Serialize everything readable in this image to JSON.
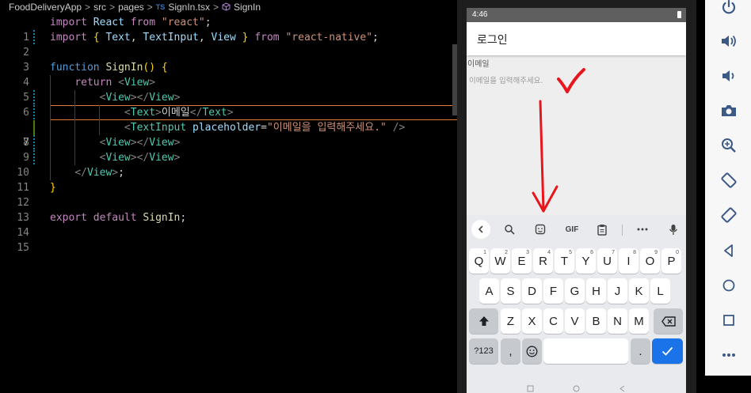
{
  "breadcrumb": {
    "items": [
      "FoodDeliveryApp",
      "src",
      "pages"
    ],
    "file_badge": "TS",
    "file": "SignIn.tsx",
    "symbol": "SignIn",
    "separator": ">"
  },
  "code": {
    "line_numbers": [
      "1",
      "2",
      "3",
      "4",
      "5",
      "6",
      "7",
      "8",
      "9",
      "10",
      "11",
      "12",
      "13",
      "14",
      "15"
    ],
    "active_line": "7"
  },
  "emulator": {
    "status_time": "4:46",
    "app_title": "로그인",
    "label": "이메일",
    "input_placeholder": "이메일을 입력해주세요.",
    "keyboard": {
      "gif_label": "GIF",
      "row1": [
        {
          "k": "Q",
          "n": "1"
        },
        {
          "k": "W",
          "n": "2"
        },
        {
          "k": "E",
          "n": "3"
        },
        {
          "k": "R",
          "n": "4"
        },
        {
          "k": "T",
          "n": "5"
        },
        {
          "k": "Y",
          "n": "6"
        },
        {
          "k": "U",
          "n": "7"
        },
        {
          "k": "I",
          "n": "8"
        },
        {
          "k": "O",
          "n": "9"
        },
        {
          "k": "P",
          "n": "0"
        }
      ],
      "row2": [
        "A",
        "S",
        "D",
        "F",
        "G",
        "H",
        "J",
        "K",
        "L"
      ],
      "row3": [
        "Z",
        "X",
        "C",
        "V",
        "B",
        "N",
        "M"
      ],
      "symbols_key": "?123",
      "comma_key": ",",
      "period_key": "."
    }
  },
  "colors": {
    "accent_blue": "#1a73e8",
    "annotation_red": "#e8161c",
    "current_line_border": "#e07b3b"
  }
}
